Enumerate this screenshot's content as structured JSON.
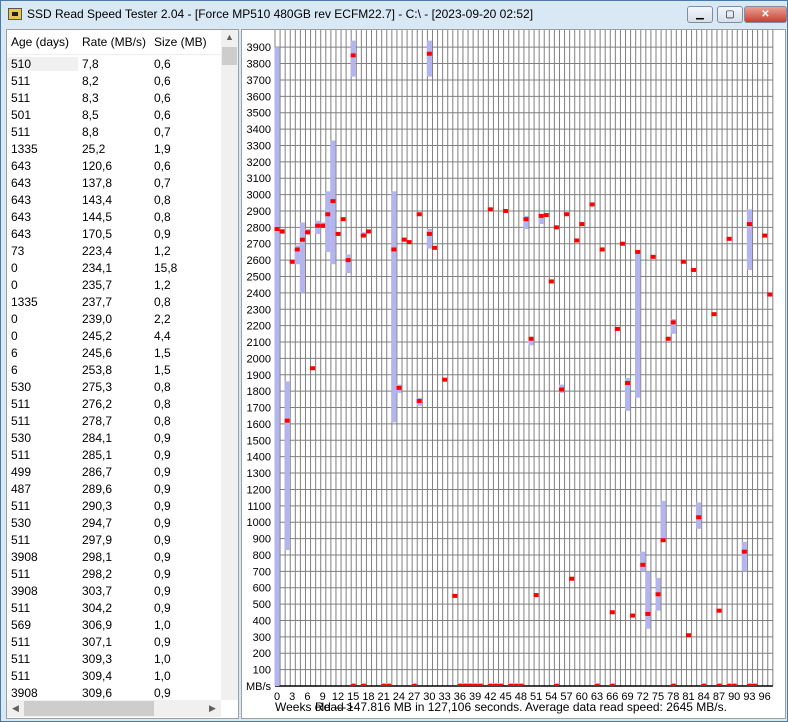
{
  "window": {
    "title": "SSD Read Speed Tester 2.04 - [Force MP510 480GB rev ECFM22.7] - C:\\ - [2023-09-20 02:52]",
    "min": "▁",
    "max": "▢",
    "close": "✕"
  },
  "table": {
    "headers": [
      "Age (days)",
      "Rate (MB/s)",
      "Size (MB)"
    ],
    "rows": [
      [
        "510",
        "7,8",
        "0,6"
      ],
      [
        "511",
        "8,2",
        "0,6"
      ],
      [
        "511",
        "8,3",
        "0,6"
      ],
      [
        "501",
        "8,5",
        "0,6"
      ],
      [
        "511",
        "8,8",
        "0,7"
      ],
      [
        "1335",
        "25,2",
        "1,9"
      ],
      [
        "643",
        "120,6",
        "0,6"
      ],
      [
        "643",
        "137,8",
        "0,7"
      ],
      [
        "643",
        "143,4",
        "0,8"
      ],
      [
        "643",
        "144,5",
        "0,8"
      ],
      [
        "643",
        "170,5",
        "0,9"
      ],
      [
        "73",
        "223,4",
        "1,2"
      ],
      [
        "0",
        "234,1",
        "15,8"
      ],
      [
        "0",
        "235,7",
        "1,2"
      ],
      [
        "1335",
        "237,7",
        "0,8"
      ],
      [
        "0",
        "239,0",
        "2,2"
      ],
      [
        "0",
        "245,2",
        "4,4"
      ],
      [
        "6",
        "245,6",
        "1,5"
      ],
      [
        "6",
        "253,8",
        "1,5"
      ],
      [
        "530",
        "275,3",
        "0,8"
      ],
      [
        "511",
        "276,2",
        "0,8"
      ],
      [
        "511",
        "278,7",
        "0,8"
      ],
      [
        "530",
        "284,1",
        "0,9"
      ],
      [
        "511",
        "285,1",
        "0,9"
      ],
      [
        "499",
        "286,7",
        "0,9"
      ],
      [
        "487",
        "289,6",
        "0,9"
      ],
      [
        "511",
        "290,3",
        "0,9"
      ],
      [
        "530",
        "294,7",
        "0,9"
      ],
      [
        "511",
        "297,9",
        "0,9"
      ],
      [
        "3908",
        "298,1",
        "0,9"
      ],
      [
        "511",
        "298,2",
        "0,9"
      ],
      [
        "3908",
        "303,7",
        "0,9"
      ],
      [
        "511",
        "304,2",
        "0,9"
      ],
      [
        "569",
        "306,9",
        "1,0"
      ],
      [
        "511",
        "307,1",
        "0,9"
      ],
      [
        "511",
        "309,3",
        "1,0"
      ],
      [
        "511",
        "309,4",
        "1,0"
      ],
      [
        "3908",
        "309,6",
        "0,9"
      ]
    ]
  },
  "status": {
    "weeks_label": "Weeks old --->",
    "read": "Read 147.816 MB in 127,106 seconds.",
    "avg": "Average data read speed: 2645 MB/s."
  },
  "chart_data": {
    "type": "scatter",
    "ylabel": "MB/s",
    "xlabel": "Weeks old",
    "ylim": [
      0,
      3900
    ],
    "xlim": [
      0,
      96
    ],
    "yticks_step": 100,
    "xticks_step": 3,
    "colors": {
      "mark": "#ff0000",
      "range": "#b4b4f0",
      "grid": "#808080"
    },
    "points": [
      [
        0,
        2790,
        0,
        3900
      ],
      [
        1,
        2775,
        2760,
        2790
      ],
      [
        2,
        1620,
        830,
        1860
      ],
      [
        3,
        2590,
        2575,
        2600
      ],
      [
        4,
        2665,
        2575,
        2690
      ],
      [
        5,
        2725,
        2400,
        2830
      ],
      [
        6,
        2770,
        2755,
        2790
      ],
      [
        7,
        1940,
        1930,
        1950
      ],
      [
        8,
        2810,
        2760,
        2840
      ],
      [
        9,
        2810,
        2800,
        2830
      ],
      [
        10,
        2880,
        2650,
        3020
      ],
      [
        11,
        2960,
        2575,
        3330
      ],
      [
        12,
        2760,
        2750,
        2770
      ],
      [
        13,
        2850,
        2840,
        2860
      ],
      [
        14,
        2600,
        2520,
        2635
      ],
      [
        15,
        3850,
        3720,
        3940
      ],
      [
        17,
        2750,
        2740,
        2770
      ],
      [
        18,
        2775,
        2765,
        2785
      ],
      [
        23,
        2665,
        1610,
        3020
      ],
      [
        24,
        1820,
        1790,
        1840
      ],
      [
        25,
        2725,
        2715,
        2735
      ],
      [
        26,
        2710,
        2695,
        2720
      ],
      [
        28,
        2880,
        2870,
        2890
      ],
      [
        28,
        1740,
        1710,
        1760
      ],
      [
        30,
        3860,
        3720,
        3940
      ],
      [
        30,
        2760,
        2670,
        2790
      ],
      [
        31,
        2675,
        2665,
        2685
      ],
      [
        33,
        1870,
        1860,
        1880
      ],
      [
        35,
        550,
        540,
        560
      ],
      [
        42,
        2910,
        2900,
        2920
      ],
      [
        45,
        2900,
        2890,
        2910
      ],
      [
        49,
        2850,
        2790,
        2870
      ],
      [
        50,
        2120,
        2080,
        2130
      ],
      [
        51,
        555,
        545,
        565
      ],
      [
        52,
        2870,
        2820,
        2880
      ],
      [
        53,
        2875,
        2865,
        2885
      ],
      [
        54,
        2470,
        2460,
        2480
      ],
      [
        55,
        2800,
        2790,
        2810
      ],
      [
        56,
        1810,
        1790,
        1840
      ],
      [
        57,
        2880,
        2870,
        2890
      ],
      [
        58,
        655,
        645,
        665
      ],
      [
        59,
        2720,
        2710,
        2730
      ],
      [
        60,
        2820,
        2810,
        2830
      ],
      [
        62,
        2940,
        2930,
        2950
      ],
      [
        64,
        2665,
        2655,
        2675
      ],
      [
        66,
        450,
        440,
        460
      ],
      [
        67,
        2180,
        2170,
        2190
      ],
      [
        68,
        2700,
        2690,
        2710
      ],
      [
        69,
        1850,
        1680,
        1880
      ],
      [
        70,
        430,
        420,
        440
      ],
      [
        71,
        2650,
        1760,
        2660
      ],
      [
        72,
        740,
        700,
        820
      ],
      [
        73,
        440,
        350,
        700
      ],
      [
        74,
        2620,
        2610,
        2630
      ],
      [
        75,
        560,
        460,
        660
      ],
      [
        76,
        890,
        880,
        1130
      ],
      [
        77,
        2120,
        2110,
        2130
      ],
      [
        78,
        2220,
        2150,
        2240
      ],
      [
        80,
        2590,
        2580,
        2600
      ],
      [
        81,
        310,
        300,
        320
      ],
      [
        82,
        2540,
        2530,
        2550
      ],
      [
        83,
        1030,
        960,
        1120
      ],
      [
        86,
        2270,
        2260,
        2280
      ],
      [
        87,
        460,
        450,
        470
      ],
      [
        89,
        2730,
        2720,
        2740
      ],
      [
        92,
        820,
        700,
        880
      ],
      [
        93,
        2820,
        2540,
        2910
      ],
      [
        96,
        2750,
        2740,
        2760
      ],
      [
        97,
        2390,
        2380,
        2400
      ]
    ],
    "zero_weeks": [
      15,
      17,
      21,
      22,
      27,
      36,
      37,
      38,
      39,
      40,
      42,
      43,
      44,
      46,
      47,
      48,
      55,
      63,
      66,
      78,
      84,
      87,
      89,
      90,
      93,
      94
    ]
  }
}
